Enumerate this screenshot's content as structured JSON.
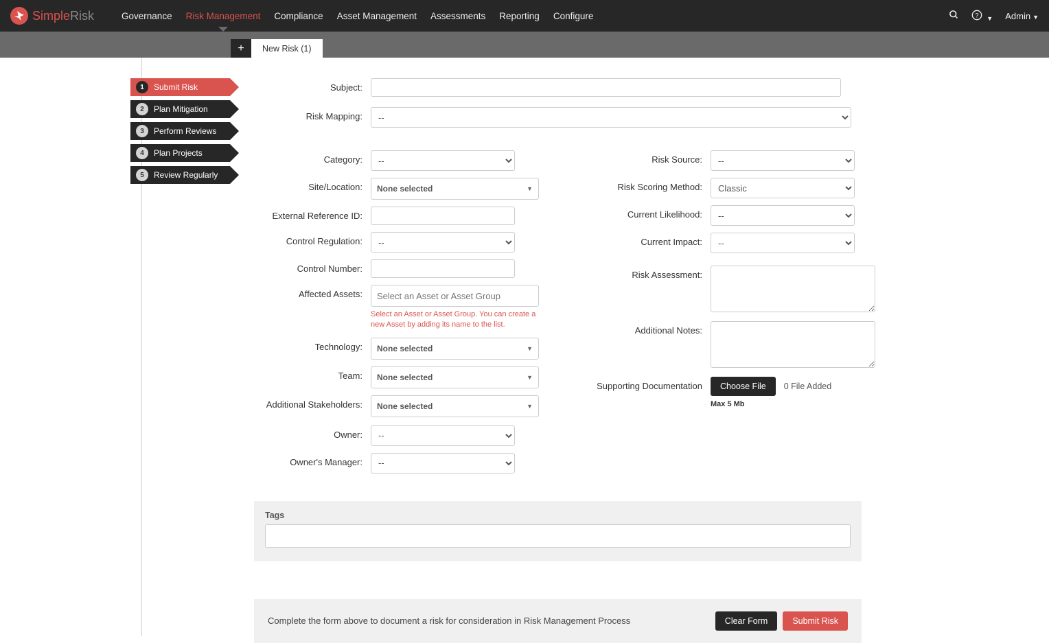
{
  "brand": {
    "simple": "Simple",
    "risk": "Risk"
  },
  "nav": {
    "items": [
      "Governance",
      "Risk Management",
      "Compliance",
      "Asset Management",
      "Assessments",
      "Reporting",
      "Configure"
    ],
    "active_index": 1
  },
  "header_right": {
    "admin": "Admin"
  },
  "tabs": {
    "plus": "+",
    "new_risk": "New Risk (1)"
  },
  "steps": [
    {
      "num": "1",
      "label": "Submit Risk"
    },
    {
      "num": "2",
      "label": "Plan Mitigation"
    },
    {
      "num": "3",
      "label": "Perform Reviews"
    },
    {
      "num": "4",
      "label": "Plan Projects"
    },
    {
      "num": "5",
      "label": "Review Regularly"
    }
  ],
  "labels": {
    "subject": "Subject:",
    "risk_mapping": "Risk Mapping:",
    "category": "Category:",
    "site_location": "Site/Location:",
    "external_ref": "External Reference ID:",
    "control_regulation": "Control Regulation:",
    "control_number": "Control Number:",
    "affected_assets": "Affected Assets:",
    "technology": "Technology:",
    "team": "Team:",
    "additional_stakeholders": "Additional Stakeholders:",
    "owner": "Owner:",
    "owners_manager": "Owner's Manager:",
    "risk_source": "Risk Source:",
    "risk_scoring_method": "Risk Scoring Method:",
    "current_likelihood": "Current Likelihood:",
    "current_impact": "Current Impact:",
    "risk_assessment": "Risk Assessment:",
    "additional_notes": "Additional Notes:",
    "supporting_doc": "Supporting Documentation"
  },
  "values": {
    "dash": "--",
    "none_selected": "None selected",
    "classic": "Classic",
    "asset_placeholder": "Select an Asset or Asset Group",
    "asset_helper": "Select an Asset or Asset Group. You can create a new Asset by adding its name to the list.",
    "choose_file": "Choose File",
    "file_added": "0 File Added",
    "max_size": "Max 5 Mb"
  },
  "tags": {
    "title": "Tags"
  },
  "footer": {
    "text": "Complete the form above to document a risk for consideration in Risk Management Process",
    "clear": "Clear Form",
    "submit": "Submit Risk"
  }
}
